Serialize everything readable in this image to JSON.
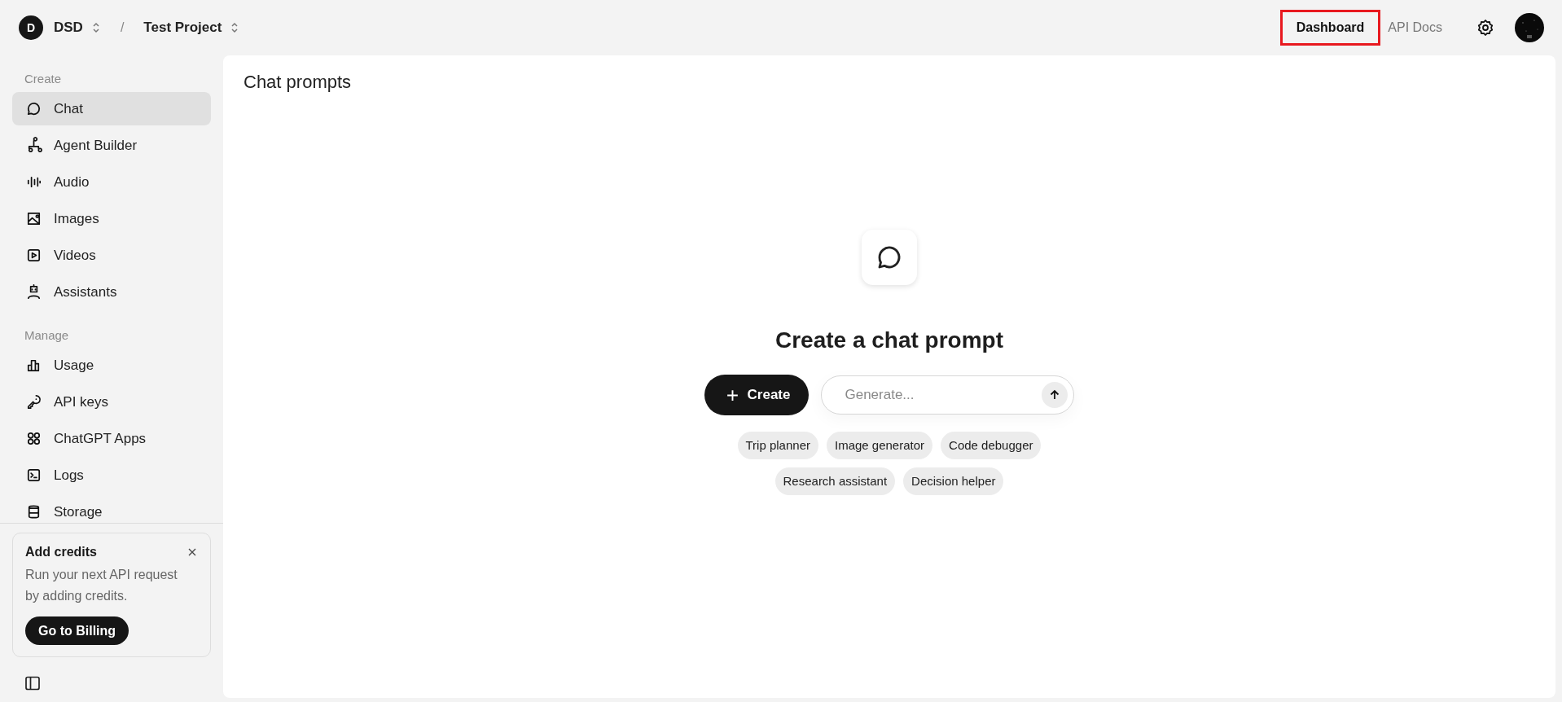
{
  "topbar": {
    "org": {
      "initial": "D",
      "name": "DSD"
    },
    "separator": "/",
    "project": "Test Project",
    "links": [
      {
        "label": "Dashboard",
        "highlighted": true
      },
      {
        "label": "API Docs",
        "highlighted": false
      }
    ]
  },
  "sidebar": {
    "sections": [
      {
        "heading": "Create",
        "items": [
          {
            "label": "Chat",
            "selected": true
          },
          {
            "label": "Agent Builder",
            "selected": false
          },
          {
            "label": "Audio",
            "selected": false
          },
          {
            "label": "Images",
            "selected": false
          },
          {
            "label": "Videos",
            "selected": false
          },
          {
            "label": "Assistants",
            "selected": false
          }
        ]
      },
      {
        "heading": "Manage",
        "items": [
          {
            "label": "Usage",
            "selected": false
          },
          {
            "label": "API keys",
            "selected": false
          },
          {
            "label": "ChatGPT Apps",
            "selected": false
          },
          {
            "label": "Logs",
            "selected": false
          },
          {
            "label": "Storage",
            "selected": false
          }
        ]
      }
    ],
    "promo": {
      "title": "Add credits",
      "text": "Run your next API request by adding credits.",
      "button": "Go to Billing"
    }
  },
  "main": {
    "title": "Chat prompts",
    "heading": "Create a chat prompt",
    "create_button": "Create",
    "generate": {
      "placeholder": "Generate..."
    },
    "suggestions": [
      [
        "Trip planner",
        "Image generator",
        "Code debugger"
      ],
      [
        "Research assistant",
        "Decision helper"
      ]
    ]
  }
}
